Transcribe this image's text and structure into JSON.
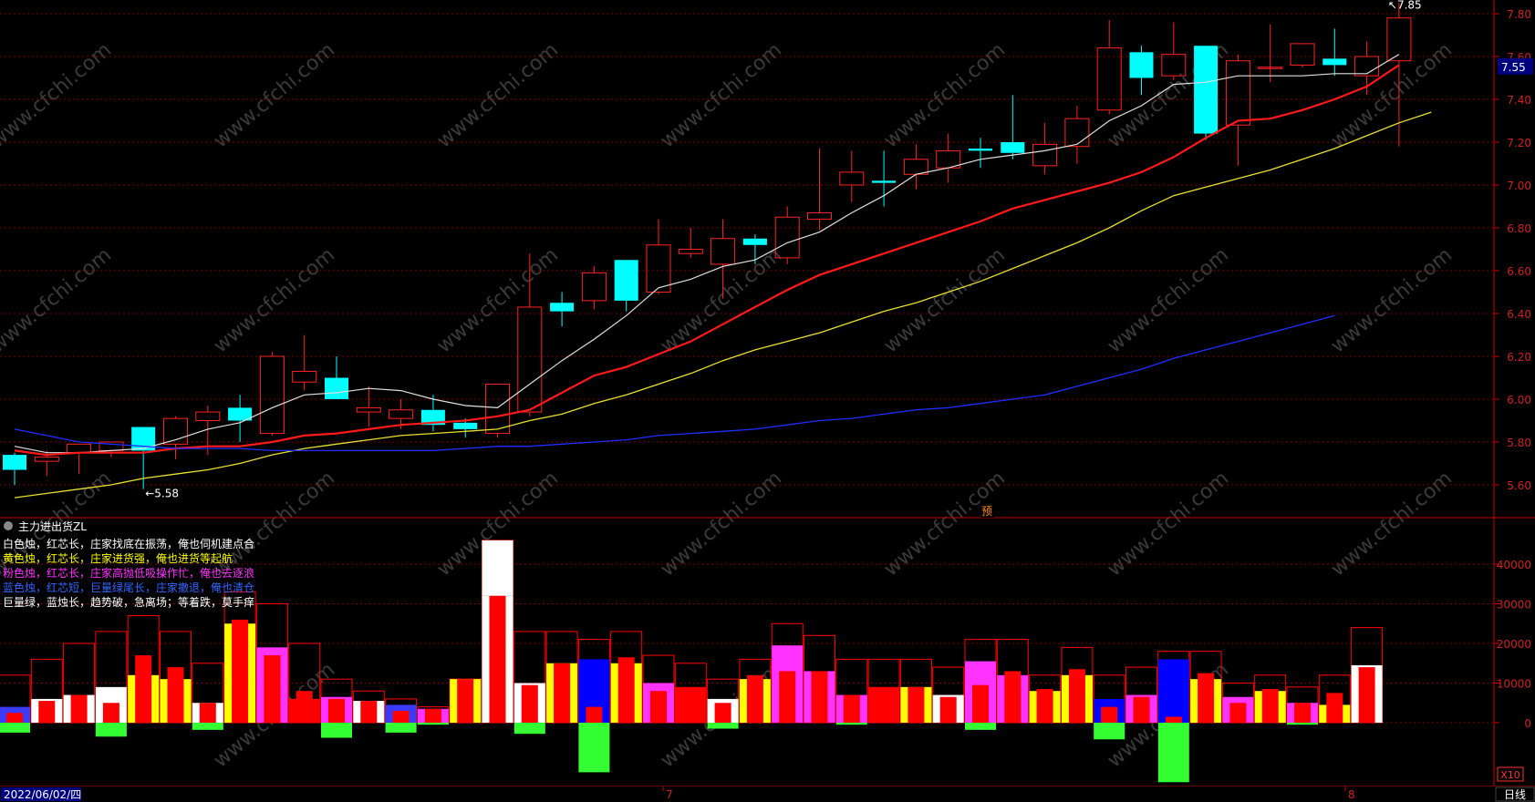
{
  "chart_data": [
    {
      "type": "candlestick",
      "panel": "main",
      "period": "日线",
      "ylim": [
        5.5,
        7.9
      ],
      "y_ticks": [
        "7.80",
        "7.60",
        "7.40",
        "7.20",
        "7.00",
        "6.80",
        "6.60",
        "6.40",
        "6.20",
        "6.00",
        "5.80",
        "5.60"
      ],
      "current_price": "7.55",
      "annotations": {
        "low": "5.58",
        "high": "7.85",
        "pre_marker": "预"
      },
      "candles": [
        {
          "o": 5.74,
          "h": 5.75,
          "l": 5.6,
          "c": 5.67
        },
        {
          "o": 5.71,
          "h": 5.76,
          "l": 5.64,
          "c": 5.73
        },
        {
          "o": 5.75,
          "h": 5.79,
          "l": 5.65,
          "c": 5.79
        },
        {
          "o": 5.76,
          "h": 5.8,
          "l": 5.73,
          "c": 5.8
        },
        {
          "o": 5.87,
          "h": 5.87,
          "l": 5.58,
          "c": 5.76
        },
        {
          "o": 5.79,
          "h": 5.92,
          "l": 5.72,
          "c": 5.91
        },
        {
          "o": 5.9,
          "h": 5.97,
          "l": 5.74,
          "c": 5.94
        },
        {
          "o": 5.96,
          "h": 6.02,
          "l": 5.8,
          "c": 5.9
        },
        {
          "o": 5.84,
          "h": 6.22,
          "l": 5.83,
          "c": 6.2
        },
        {
          "o": 6.08,
          "h": 6.3,
          "l": 6.04,
          "c": 6.13
        },
        {
          "o": 6.1,
          "h": 6.2,
          "l": 6.0,
          "c": 6.0
        },
        {
          "o": 5.94,
          "h": 6.06,
          "l": 5.87,
          "c": 5.96
        },
        {
          "o": 5.91,
          "h": 6.0,
          "l": 5.86,
          "c": 5.95
        },
        {
          "o": 5.95,
          "h": 6.02,
          "l": 5.85,
          "c": 5.88
        },
        {
          "o": 5.89,
          "h": 5.91,
          "l": 5.82,
          "c": 5.86
        },
        {
          "o": 5.84,
          "h": 6.07,
          "l": 5.82,
          "c": 6.07
        },
        {
          "o": 5.94,
          "h": 6.68,
          "l": 5.92,
          "c": 6.43
        },
        {
          "o": 6.45,
          "h": 6.5,
          "l": 6.34,
          "c": 6.41
        },
        {
          "o": 6.46,
          "h": 6.62,
          "l": 6.42,
          "c": 6.59
        },
        {
          "o": 6.65,
          "h": 6.65,
          "l": 6.41,
          "c": 6.46
        },
        {
          "o": 6.5,
          "h": 6.84,
          "l": 6.49,
          "c": 6.72
        },
        {
          "o": 6.68,
          "h": 6.8,
          "l": 6.66,
          "c": 6.7
        },
        {
          "o": 6.63,
          "h": 6.84,
          "l": 6.47,
          "c": 6.75
        },
        {
          "o": 6.75,
          "h": 6.77,
          "l": 6.63,
          "c": 6.72
        },
        {
          "o": 6.66,
          "h": 6.9,
          "l": 6.63,
          "c": 6.85
        },
        {
          "o": 6.84,
          "h": 7.17,
          "l": 6.79,
          "c": 6.87
        },
        {
          "o": 7.0,
          "h": 7.16,
          "l": 6.92,
          "c": 7.06
        },
        {
          "o": 7.02,
          "h": 7.16,
          "l": 6.9,
          "c": 7.01
        },
        {
          "o": 7.05,
          "h": 7.19,
          "l": 6.98,
          "c": 7.12
        },
        {
          "o": 7.08,
          "h": 7.24,
          "l": 7.01,
          "c": 7.16
        },
        {
          "o": 7.17,
          "h": 7.22,
          "l": 7.08,
          "c": 7.16
        },
        {
          "o": 7.2,
          "h": 7.42,
          "l": 7.12,
          "c": 7.15
        },
        {
          "o": 7.09,
          "h": 7.29,
          "l": 7.05,
          "c": 7.19
        },
        {
          "o": 7.18,
          "h": 7.37,
          "l": 7.1,
          "c": 7.31
        },
        {
          "o": 7.35,
          "h": 7.77,
          "l": 7.33,
          "c": 7.64
        },
        {
          "o": 7.62,
          "h": 7.65,
          "l": 7.42,
          "c": 7.5
        },
        {
          "o": 7.51,
          "h": 7.76,
          "l": 7.49,
          "c": 7.61
        },
        {
          "o": 7.65,
          "h": 7.65,
          "l": 7.21,
          "c": 7.24
        },
        {
          "o": 7.28,
          "h": 7.61,
          "l": 7.09,
          "c": 7.58
        },
        {
          "o": 7.55,
          "h": 7.75,
          "l": 7.48,
          "c": 7.55
        },
        {
          "o": 7.56,
          "h": 7.66,
          "l": 7.55,
          "c": 7.66
        },
        {
          "o": 7.59,
          "h": 7.73,
          "l": 7.51,
          "c": 7.56
        },
        {
          "o": 7.51,
          "h": 7.67,
          "l": 7.42,
          "c": 7.6
        },
        {
          "o": 7.58,
          "h": 7.85,
          "l": 7.18,
          "c": 7.78
        }
      ],
      "ma": [
        {
          "color": "#e0e0e0",
          "width": 1.2,
          "values": [
            5.78,
            5.75,
            5.75,
            5.76,
            5.77,
            5.81,
            5.86,
            5.89,
            5.96,
            6.02,
            6.03,
            6.05,
            6.04,
            6.0,
            5.97,
            5.96,
            6.07,
            6.18,
            6.28,
            6.39,
            6.52,
            6.56,
            6.62,
            6.65,
            6.73,
            6.78,
            6.87,
            6.95,
            7.05,
            7.08,
            7.12,
            7.14,
            7.16,
            7.19,
            7.3,
            7.37,
            7.47,
            7.48,
            7.51,
            7.51,
            7.51,
            7.52,
            7.52,
            7.61
          ]
        },
        {
          "color": "#ff1a1a",
          "width": 2.2,
          "values": [
            5.76,
            5.74,
            5.75,
            5.75,
            5.75,
            5.77,
            5.78,
            5.78,
            5.8,
            5.83,
            5.84,
            5.86,
            5.88,
            5.89,
            5.9,
            5.92,
            5.95,
            6.03,
            6.11,
            6.15,
            6.21,
            6.27,
            6.35,
            6.43,
            6.51,
            6.58,
            6.63,
            6.68,
            6.73,
            6.78,
            6.83,
            6.89,
            6.93,
            6.97,
            7.01,
            7.06,
            7.13,
            7.22,
            7.3,
            7.31,
            7.35,
            7.4,
            7.46,
            7.56
          ]
        },
        {
          "color": "#e8e030",
          "width": 1.3,
          "values": [
            5.54,
            5.56,
            5.58,
            5.6,
            5.63,
            5.65,
            5.67,
            5.7,
            5.74,
            5.77,
            5.79,
            5.81,
            5.83,
            5.84,
            5.85,
            5.86,
            5.9,
            5.93,
            5.98,
            6.02,
            6.07,
            6.12,
            6.18,
            6.23,
            6.27,
            6.31,
            6.36,
            6.41,
            6.45,
            6.5,
            6.55,
            6.61,
            6.67,
            6.73,
            6.8,
            6.88,
            6.95,
            6.99,
            7.03,
            7.07,
            7.12,
            7.17,
            7.23,
            7.29,
            7.34
          ]
        },
        {
          "color": "#1e2eff",
          "width": 1.3,
          "values": [
            5.86,
            5.83,
            5.8,
            5.79,
            5.78,
            5.77,
            5.77,
            5.77,
            5.76,
            5.76,
            5.76,
            5.76,
            5.76,
            5.76,
            5.77,
            5.78,
            5.78,
            5.79,
            5.8,
            5.81,
            5.83,
            5.84,
            5.85,
            5.86,
            5.88,
            5.9,
            5.91,
            5.93,
            5.95,
            5.96,
            5.98,
            6.0,
            6.02,
            6.06,
            6.1,
            6.14,
            6.19,
            6.23,
            6.27,
            6.31,
            6.35,
            6.39
          ]
        }
      ]
    },
    {
      "type": "bar",
      "panel": "indicator",
      "title": "主力进出货ZL",
      "y_ticks": [
        "40000",
        "30000",
        "20000",
        "10000",
        "0"
      ],
      "ylim": [
        -16000,
        46000
      ],
      "scale_label": "X10",
      "legend": [
        {
          "text": "白色烛，红芯长，庄家找底在振荡，俺也伺机建点合",
          "color": "#ffffff"
        },
        {
          "text": "黄色烛，红芯长，庄家进货强，俺也进货等起航",
          "color": "#ffff00"
        },
        {
          "text": "粉色烛，红芯长，庄家高抛低吸操作忙，俺也去逐浪",
          "color": "#ff33ff"
        },
        {
          "text": "蓝色烛，红芯短，巨量绿尾长，庄家撤退，俺也清仓",
          "color": "#3366ff"
        },
        {
          "text": "巨量绿，蓝烛长，趋势破，急离场；等着跌，莫手痒",
          "color": "#ffffff"
        }
      ],
      "bars": [
        {
          "o": 12000,
          "c": 4000,
          "i": 2500,
          "n": -2500
        },
        {
          "o": 16000,
          "c": 6000,
          "i": 5500,
          "n": 0
        },
        {
          "o": 20000,
          "c": 7000,
          "i": 7000,
          "n": 0
        },
        {
          "o": 23000,
          "c": 9000,
          "i": 5000,
          "n": -3500
        },
        {
          "o": 27000,
          "c": 12000,
          "i": 17000,
          "n": 0
        },
        {
          "o": 23000,
          "c": 11000,
          "i": 14000,
          "n": 0
        },
        {
          "o": 15000,
          "c": 5000,
          "i": 5000,
          "n": -1800
        },
        {
          "o": 33000,
          "c": 25000,
          "i": 26000,
          "n": 0
        },
        {
          "o": 30000,
          "c": 19000,
          "i": 17000,
          "n": 0
        },
        {
          "o": 20000,
          "c": 6000,
          "i": 8000,
          "n": 0
        },
        {
          "o": 11000,
          "c": 6500,
          "i": 6000,
          "n": -3800
        },
        {
          "o": 8000,
          "c": 5500,
          "i": 5500,
          "n": 0
        },
        {
          "o": 6000,
          "c": 4500,
          "i": 3000,
          "n": -2500
        },
        {
          "o": 4000,
          "c": 3500,
          "i": 3500,
          "n": -500
        },
        {
          "o": 11000,
          "c": 11000,
          "i": 11000,
          "n": 0
        },
        {
          "o": 46000,
          "c": 32000,
          "i": 32000,
          "n": 0,
          "white_top": 46000
        },
        {
          "o": 23000,
          "c": 10000,
          "i": 9500,
          "n": -2800
        },
        {
          "o": 23000,
          "c": 15000,
          "i": 15000,
          "n": 0
        },
        {
          "o": 21000,
          "c": 16000,
          "i": 4000,
          "n": -12500,
          "blue": true
        },
        {
          "o": 23000,
          "c": 15000,
          "i": 16500,
          "n": 0
        },
        {
          "o": 17000,
          "c": 10000,
          "i": 8000,
          "n": 0
        },
        {
          "o": 15000,
          "c": 9000,
          "i": 9000,
          "n": 0
        },
        {
          "o": 11000,
          "c": 6000,
          "i": 5000,
          "n": -1500
        },
        {
          "o": 16000,
          "c": 11000,
          "i": 12000,
          "n": 0
        },
        {
          "o": 25000,
          "c": 19500,
          "i": 13000,
          "n": 0
        },
        {
          "o": 22000,
          "c": 13000,
          "i": 13000,
          "n": 0
        },
        {
          "o": 16000,
          "c": 7000,
          "i": 7000,
          "n": -500
        },
        {
          "o": 16000,
          "c": 9000,
          "i": 9000,
          "n": 0
        },
        {
          "o": 16000,
          "c": 9000,
          "i": 9000,
          "n": 0
        },
        {
          "o": 14000,
          "c": 7000,
          "i": 6500,
          "n": 0
        },
        {
          "o": 21000,
          "c": 15500,
          "i": 9500,
          "n": -1800
        },
        {
          "o": 21000,
          "c": 12000,
          "i": 13000,
          "n": 0
        },
        {
          "o": 12000,
          "c": 8000,
          "i": 8500,
          "n": 0
        },
        {
          "o": 19000,
          "c": 12000,
          "i": 13500,
          "n": 0
        },
        {
          "o": 12000,
          "c": 6000,
          "i": 4000,
          "n": -4200,
          "blue": true
        },
        {
          "o": 14000,
          "c": 7000,
          "i": 6500,
          "n": 0
        },
        {
          "o": 18000,
          "c": 16000,
          "i": 1500,
          "n": -15000,
          "blue": true
        },
        {
          "o": 18000,
          "c": 11000,
          "i": 12500,
          "n": 0
        },
        {
          "o": 10000,
          "c": 6500,
          "i": 5000,
          "n": 0
        },
        {
          "o": 12000,
          "c": 8000,
          "i": 8500,
          "n": 0
        },
        {
          "o": 9000,
          "c": 5000,
          "i": 5000,
          "n": -500
        },
        {
          "o": 12000,
          "c": 4500,
          "i": 7500,
          "n": 0
        },
        {
          "o": 24000,
          "c": 14500,
          "i": 14000,
          "n": 0
        }
      ]
    }
  ],
  "x_axis": {
    "date_label": "2022/06/02/四",
    "month_labels": [
      "7",
      "8"
    ],
    "period_button": "日线"
  },
  "watermark": "www.cfchi.com",
  "colors": {
    "up": "#ff2222",
    "down": "#00ffff",
    "grid": "#7a0000",
    "axis": "#cc0000",
    "text": "#cc2222",
    "price_box": "#000080"
  }
}
